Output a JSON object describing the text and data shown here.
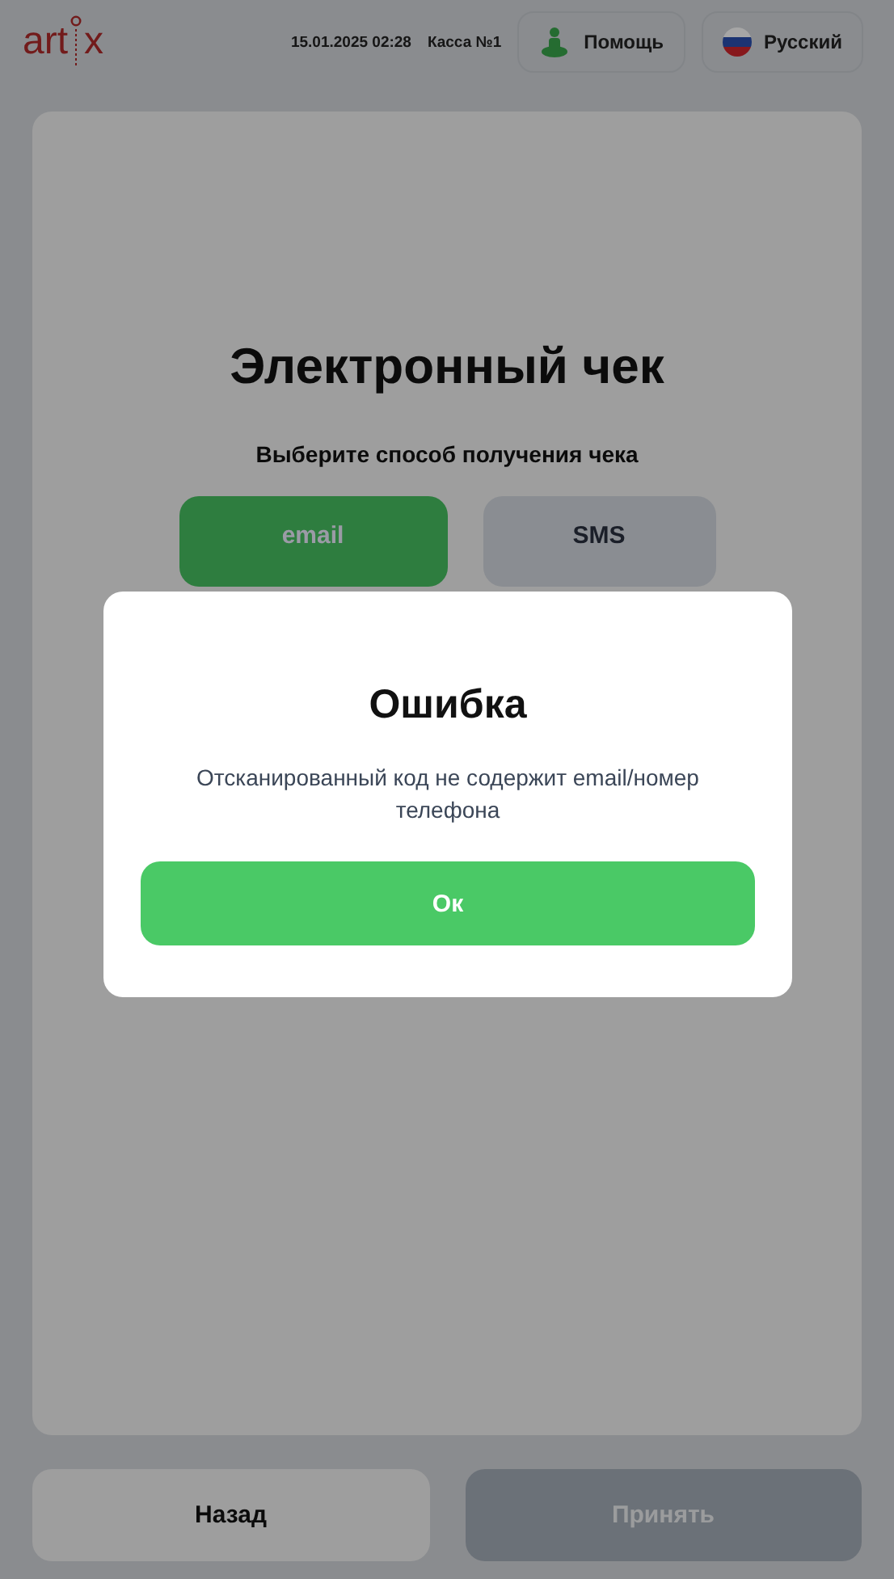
{
  "header": {
    "logo": {
      "left": "art",
      "right": "x"
    },
    "datetime": "15.01.2025 02:28",
    "register": "Касса №1",
    "help_button": "Помощь",
    "language_button": "Русский"
  },
  "card": {
    "title": "Электронный чек",
    "subtitle": "Выберите способ получения чека",
    "options": [
      {
        "label": "email",
        "selected": true
      },
      {
        "label": "SMS",
        "selected": false
      }
    ]
  },
  "footer": {
    "buttons": [
      {
        "label": "Назад",
        "disabled": false
      },
      {
        "label": "Принять",
        "disabled": true
      }
    ]
  },
  "dialog": {
    "title": "Ошибка",
    "message": "Отсканированный код не содержит email/номер телефона",
    "button": "Ок"
  }
}
